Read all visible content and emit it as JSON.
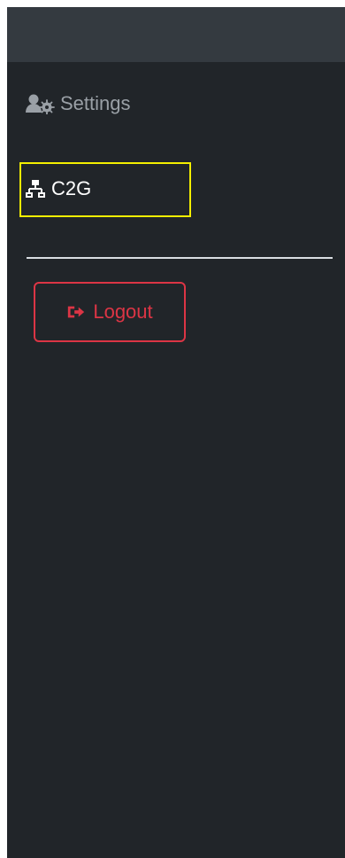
{
  "sidebar": {
    "items": [
      {
        "label": "Settings",
        "icon": "user-gear-icon"
      },
      {
        "label": "C2G",
        "icon": "network-icon"
      }
    ],
    "logout": {
      "label": "Logout",
      "icon": "logout-icon"
    }
  },
  "colors": {
    "background": "#212529",
    "topbar": "#343a40",
    "settings_text": "#9aa0a6",
    "active_text": "#ffffff",
    "danger": "#dc3545",
    "highlight": "#f4ef00",
    "divider": "#d9dde2"
  }
}
